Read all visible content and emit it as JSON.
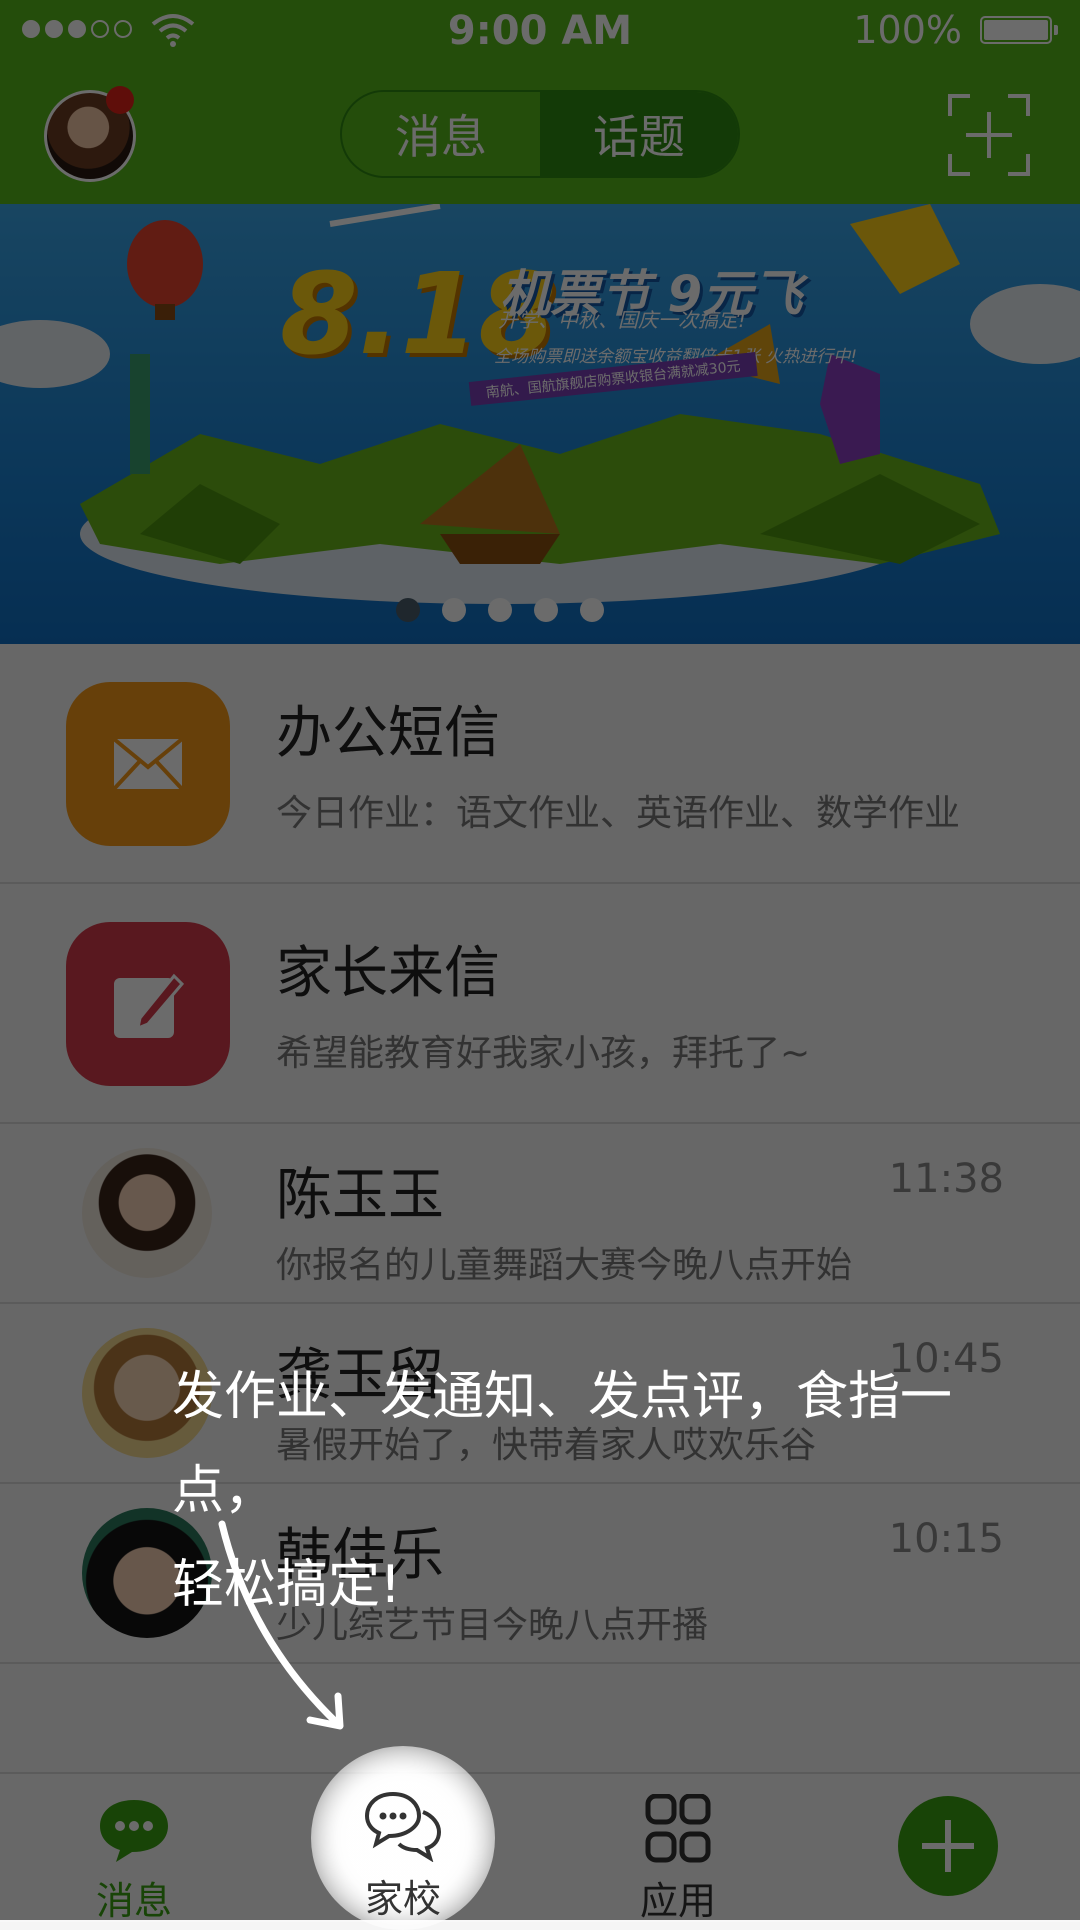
{
  "status_bar": {
    "time": "9:00 AM",
    "battery_text": "100%",
    "signal_icon": "signal-dots-icon",
    "wifi_icon": "wifi-icon",
    "battery_icon": "battery-icon"
  },
  "header": {
    "tabs": [
      {
        "label": "消息",
        "active": false
      },
      {
        "label": "话题",
        "active": true
      }
    ],
    "avatar_icon": "user-avatar",
    "scan_icon": "scan-add-icon",
    "badge_color": "#e2231a"
  },
  "banner": {
    "title": "8.18",
    "subtitle": "机票节 9元飞",
    "line1": "开学、中秋、国庆一次搞定!",
    "line2": "全场购票即送余额宝收益翻倍卡1张  火热进行中!",
    "line3": "南航、国航旗舰店购票收银台满就减30元",
    "pages": 5,
    "active_page": 0
  },
  "list": {
    "items": [
      {
        "title": "办公短信",
        "subtitle": "今日作业：语文作业、英语作业、数学作业",
        "icon": "envelope-icon",
        "color": "#f59a1a"
      },
      {
        "title": "家长来信",
        "subtitle": "希望能教育好我家小孩，拜托了~",
        "icon": "edit-icon",
        "color": "#d53a4a"
      },
      {
        "title": "陈玉玉",
        "subtitle": "你报名的儿童舞蹈大赛今晚八点开始",
        "time": "11:38"
      },
      {
        "title": "龚玉留",
        "subtitle": "暑假开始了，快带着家人哎欢乐谷",
        "time": "10:45"
      },
      {
        "title": "韩佳乐",
        "subtitle": "少儿综艺节目今晚八点开播",
        "time": "10:15"
      }
    ]
  },
  "bottom_nav": {
    "items": [
      {
        "label": "消息",
        "icon": "chat-bubble-icon",
        "active": true
      },
      {
        "label": "家校",
        "icon": "double-chat-icon",
        "active": false
      },
      {
        "label": "应用",
        "icon": "apps-grid-icon",
        "active": false
      }
    ],
    "fab_icon": "plus-icon",
    "accent": "#3aa312"
  },
  "guide": {
    "line1": "发作业、发通知、发点评，食指一点，",
    "line2": "轻松搞定!"
  }
}
